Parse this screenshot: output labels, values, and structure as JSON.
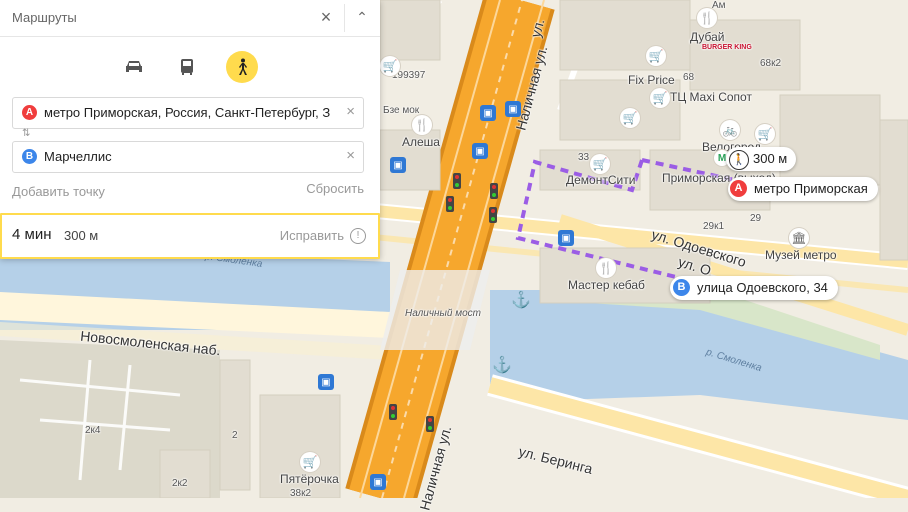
{
  "panel": {
    "title": "Маршруты",
    "close_icon": "×",
    "collapse_icon": "⌃",
    "modes": [
      {
        "name": "car-icon",
        "active": false
      },
      {
        "name": "bus-icon",
        "active": false
      },
      {
        "name": "pedestrian-icon",
        "active": true
      }
    ],
    "from": {
      "letter": "A",
      "value": "метро Приморская, Россия, Санкт-Петербург, З",
      "color": "#f03d3d"
    },
    "to": {
      "letter": "B",
      "value": "Марчеллис",
      "color": "#3c86ea"
    },
    "swap_icon": "⇅",
    "clear_icon": "×",
    "add_point": "Добавить точку",
    "reset": "Сбросить",
    "route": {
      "duration": "4 мин",
      "distance": "300 м",
      "edit": "Исправить",
      "info_icon": "!"
    }
  },
  "map": {
    "streets": {
      "nalichnaya_top": "ул.",
      "nalichnaya": "Наличная ул.",
      "novosmolenskaya": "Новосмоленская наб.",
      "odoevskogo": "ул. Одоевского",
      "odoevskogo2": "ул. О",
      "beringa": "ул. Беринга",
      "nalichnaya_bottom": "Наличная ул."
    },
    "bridge": "Наличный мост",
    "water_labels": [
      "р. Смоленка",
      "р. Смоленка"
    ],
    "places": {
      "dubai": "Дубай",
      "fix_price": "Fix Price",
      "maxi": "ТЦ Maxi Сопот",
      "velogorod": "Велогород",
      "primorskaya": "Приморская (выход)",
      "museum": "Музей метро",
      "master_kebab": "Мастер кебаб",
      "alesha": "Алеша",
      "pyaterochka": "Пятёрочка",
      "demontsity": "ДемонтСити",
      "bk": "BURGER KING",
      "amp": "Ам",
      "bzemok": "Бзе мок"
    },
    "numbers": {
      "n68k2": "68к2",
      "n68": "68",
      "n199397": "199397",
      "n33": "33",
      "n29k1": "29к1",
      "n29": "29",
      "n2k4": "2к4",
      "n2": "2",
      "n2k2": "2к2",
      "n38k2": "38к2"
    }
  },
  "route_labels": {
    "walk": "300 м",
    "a_letter": "A",
    "a_text": "метро Приморская",
    "b_letter": "B",
    "b_text": "улица Одоевского, 34"
  },
  "colors": {
    "accent": "#ffdb4d",
    "route": "#9b5de5",
    "water": "#b5d0e8",
    "road_major": "#f6a72d"
  }
}
